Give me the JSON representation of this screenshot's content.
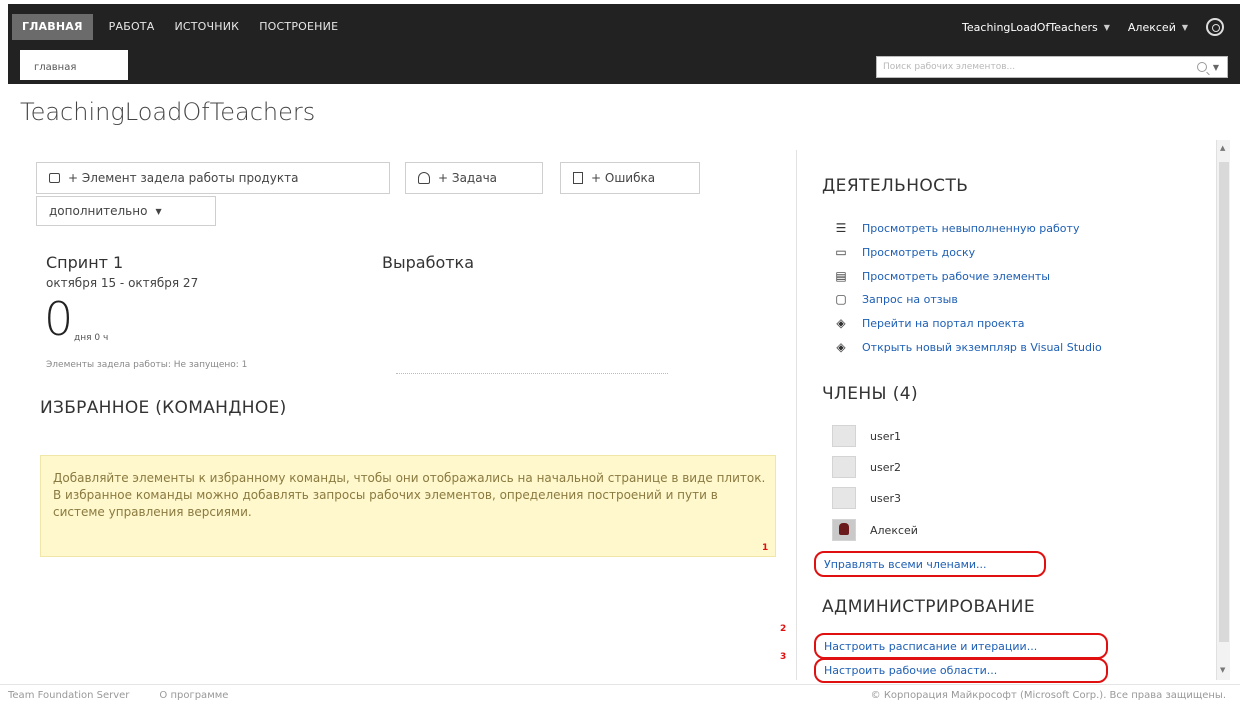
{
  "header": {
    "nav": [
      "ГЛАВНАЯ",
      "РАБОТА",
      "ИСТОЧНИК",
      "ПОСТРОЕНИЕ"
    ],
    "subtab": "главная",
    "project_menu": "TeachingLoadOfTeachers",
    "user_menu": "Алексей",
    "search_placeholder": "Поиск рабочих элементов..."
  },
  "page": {
    "title": "TeachingLoadOfTeachers"
  },
  "actions": {
    "backlog_item": "+ Элемент задела работы продукта",
    "task": "+ Задача",
    "bug": "+ Ошибка",
    "more": "дополнительно"
  },
  "sprint": {
    "name": "Спринт 1",
    "dates": "октября 15 - октября 27",
    "days_value": "0",
    "days_label": "дня 0 ч",
    "backlog_note": "Элементы задела работы: Не запущено: 1"
  },
  "burndown": {
    "title": "Выработка"
  },
  "favorites": {
    "title": "ИЗБРАННОЕ (КОМАНДНОЕ)",
    "note": "Добавляйте элементы к избранному команды, чтобы они отображались на начальной странице в виде плиток. В избранное команды можно добавлять запросы рабочих элементов, определения построений и пути в системе управления версиями."
  },
  "activity": {
    "title": "ДЕЯТЕЛЬНОСТЬ",
    "items": [
      {
        "label": "Просмотреть невыполненную работу",
        "icon": "list-icon"
      },
      {
        "label": "Просмотреть доску",
        "icon": "board-icon"
      },
      {
        "label": "Просмотреть рабочие элементы",
        "icon": "grid-icon"
      },
      {
        "label": "Запрос на отзыв",
        "icon": "feedback-icon"
      },
      {
        "label": "Перейти на портал проекта",
        "icon": "portal-icon"
      },
      {
        "label": "Открыть новый экземпляр в Visual Studio",
        "icon": "visual-studio-icon"
      }
    ]
  },
  "members": {
    "title": "ЧЛЕНЫ (4)",
    "list": [
      "user1",
      "user2",
      "user3",
      "Алексей"
    ],
    "manage_link": "Управлять всеми членами..."
  },
  "admin": {
    "title": "АДМИНИСТРИРОВАНИЕ",
    "schedule_link": "Настроить расписание и итерации...",
    "areas_link": "Настроить рабочие области..."
  },
  "annotations": [
    "1",
    "2",
    "3"
  ],
  "footer": {
    "product": "Team Foundation Server",
    "about": "О программе",
    "copyright": "© Корпорация Майкрософт (Microsoft Corp.). Все права защищены."
  },
  "colors": {
    "header_bg": "#222222",
    "link": "#1e5fb4",
    "note_bg": "#fff8cc",
    "annotation": "#e01010"
  }
}
